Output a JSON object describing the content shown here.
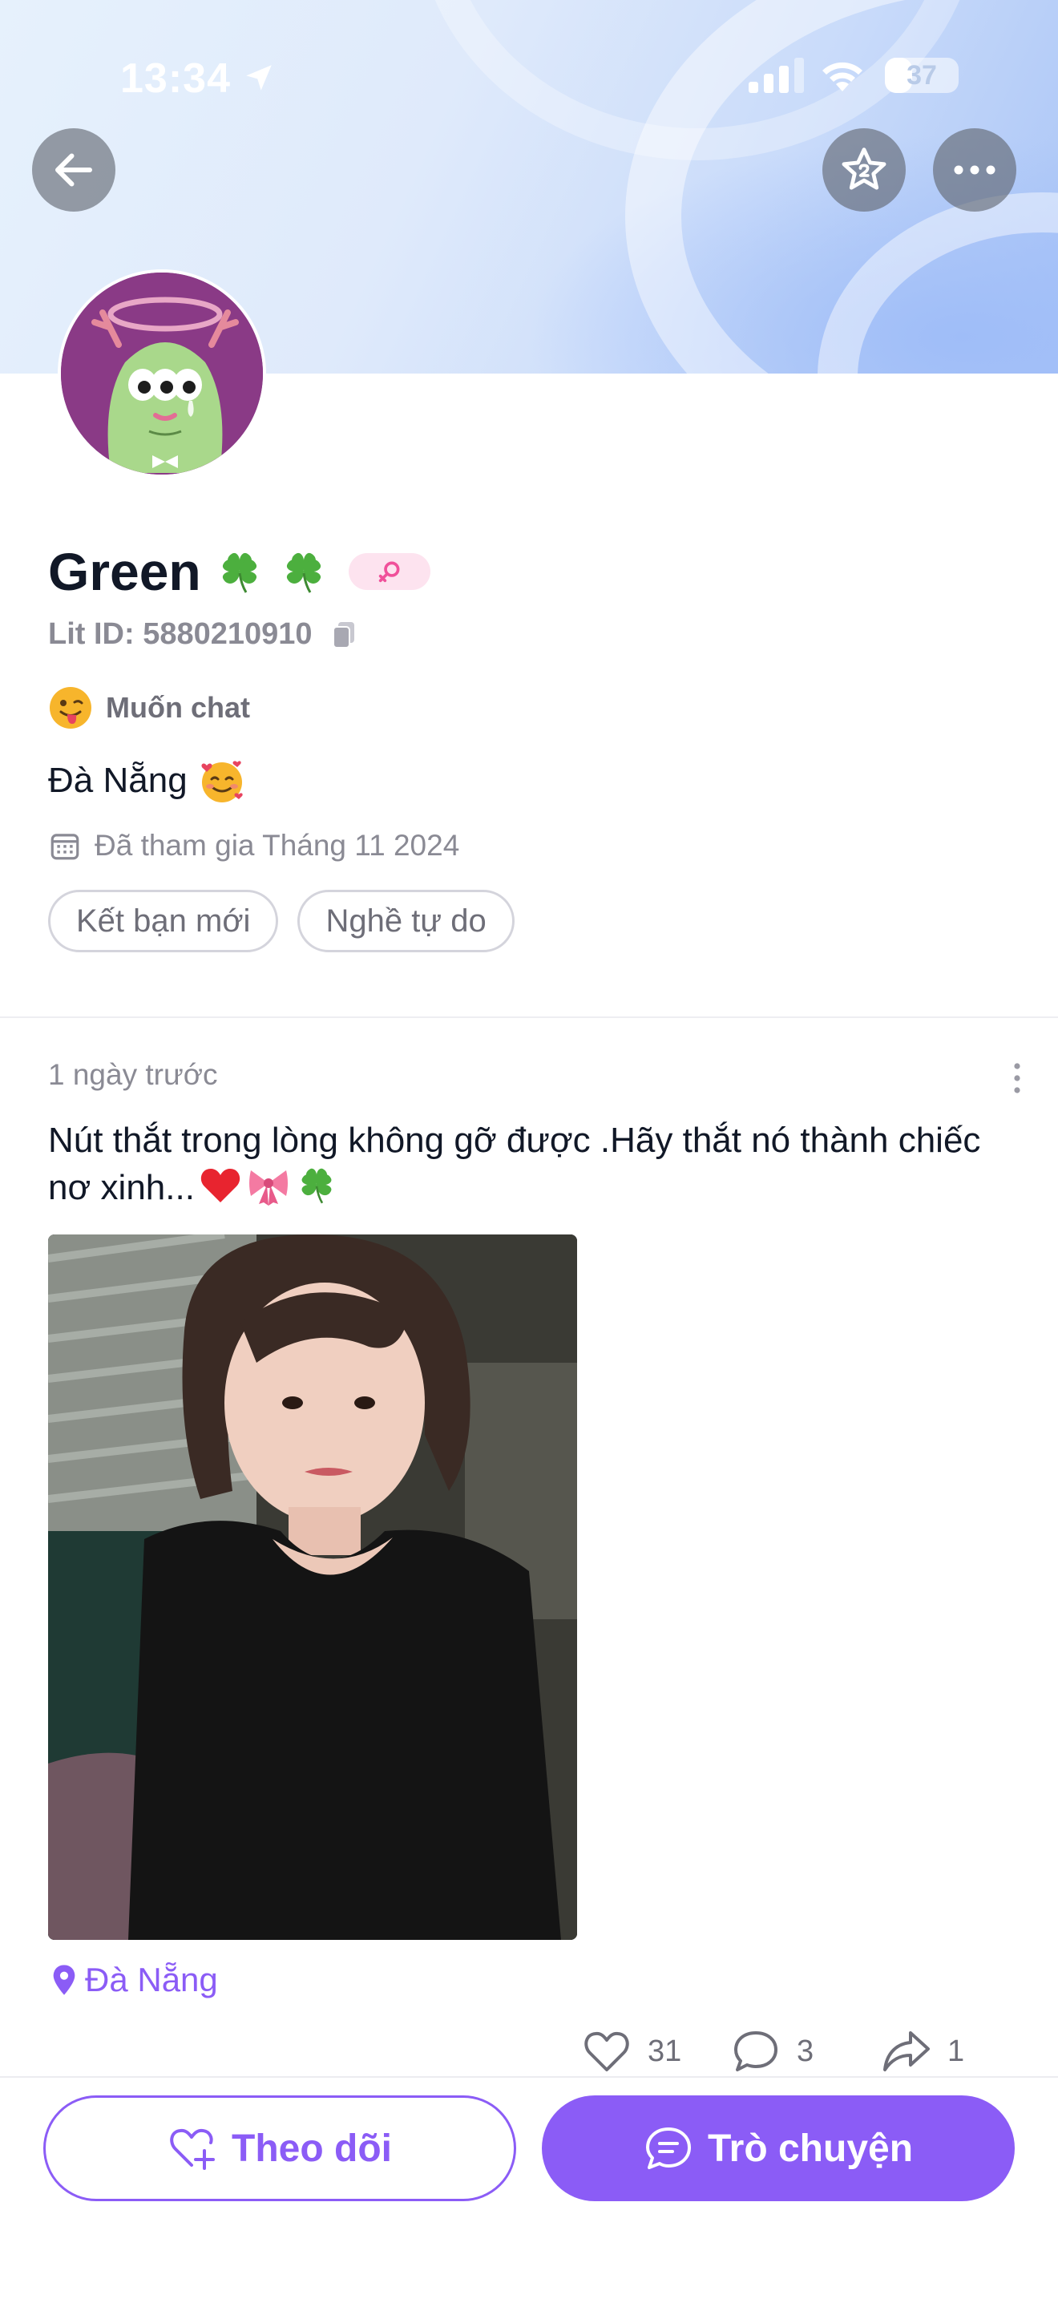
{
  "status_bar": {
    "time": "13:34",
    "battery_level": "37",
    "battery_fraction": 0.37
  },
  "header": {
    "back_icon": "arrow-left-icon",
    "favorite_icon": "star-badge-icon",
    "more_icon": "more-horizontal-icon"
  },
  "profile": {
    "name": "Green",
    "name_emojis": [
      "four-leaf-clover",
      "four-leaf-clover"
    ],
    "gender_icon": "female-icon",
    "lit_id": "Lit ID: 5880210910",
    "mood": "Muốn chat",
    "bio": "Đà Nẵng",
    "joined": "Đã tham gia Tháng 11 2024",
    "tags": [
      "Kết bạn mới",
      "Nghề tự do"
    ]
  },
  "post": {
    "time": "1 ngày trước",
    "text": "Nút thắt trong lòng không gỡ được .Hãy thắt nó thành chiếc nơ xinh...",
    "text_emojis": [
      "red-heart",
      "ribbon",
      "four-leaf-clover"
    ],
    "location": "Đà Nẵng",
    "likes": "31",
    "comments": "3",
    "shares": "1"
  },
  "actions": {
    "follow_label": "Theo dõi",
    "chat_label": "Trò chuyện"
  },
  "colors": {
    "accent": "#8b5cf6",
    "gender_pink": "#f0509a",
    "badge_bg": "#fde3ef"
  }
}
